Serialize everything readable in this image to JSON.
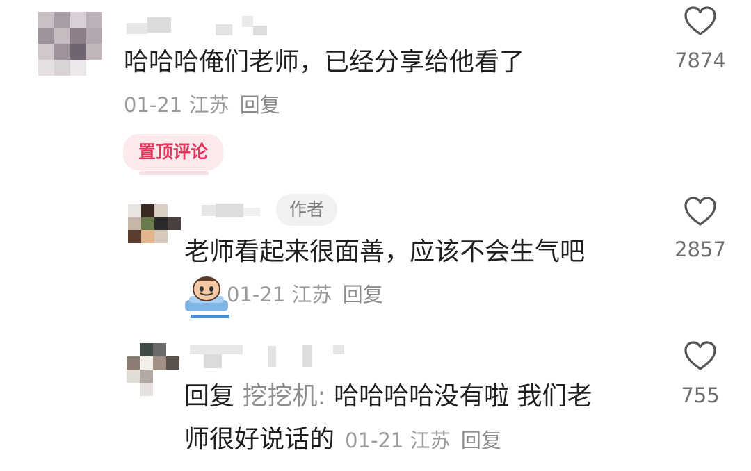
{
  "comments": [
    {
      "text": "哈哈哈俺们老师，已经分享给他看了",
      "date": "01-21",
      "location": "江苏",
      "reply_label": "回复",
      "likes": "7874",
      "pinned_label": "置顶评论"
    },
    {
      "author_tag": "作者",
      "text": "老师看起来很面善，应该不会生气吧",
      "date": "01-21",
      "location": "江苏",
      "reply_label": "回复",
      "likes": "2857",
      "emoji_icon": "crying-baby-emoji-icon"
    },
    {
      "reply_prefix": "回复",
      "mention": "挖挖机:",
      "text_line1": "哈哈哈哈没有啦 我们老",
      "text_line2": "师很好说话的",
      "date": "01-21",
      "location": "江苏",
      "reply_label": "回复",
      "likes": "755"
    }
  ],
  "icons": {
    "like": "heart-outline-icon"
  },
  "colors": {
    "pinned_text": "#e0365b",
    "pinned_bg": "#fbe9ec",
    "meta_text": "#9a9a9a"
  }
}
